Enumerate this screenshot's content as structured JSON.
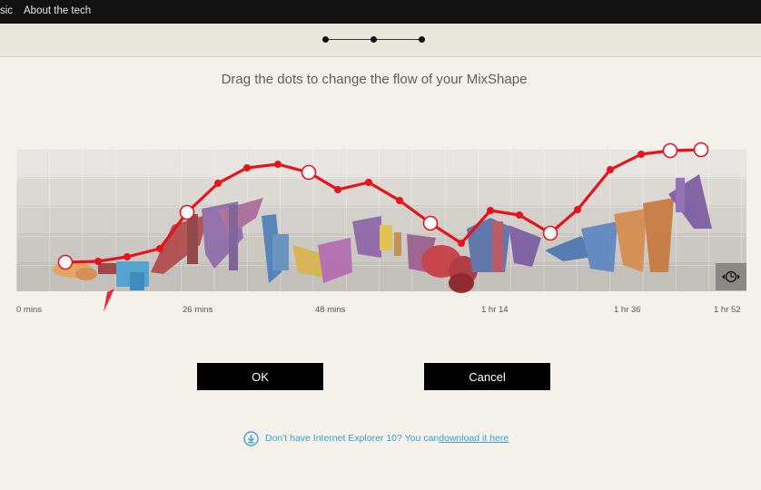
{
  "nav": {
    "music_partial": "sic",
    "about": "About the tech"
  },
  "steps": {
    "count": 3,
    "active": 2
  },
  "instruction": "Drag the dots to change the flow of your MixShape",
  "timeline": {
    "start": "0 mins",
    "labels": [
      "26 mins",
      "48 mins",
      "1 hr 14",
      "1 hr 36",
      "1 hr 52"
    ],
    "control_icon": "clock-arrows-icon"
  },
  "flow_curve_color": "#e8121b",
  "buttons": {
    "ok": "OK",
    "cancel": "Cancel"
  },
  "ie_note": {
    "icon": "download-icon",
    "text": "Don't have Internet Explorer 10? You can ",
    "link": "download it here"
  }
}
